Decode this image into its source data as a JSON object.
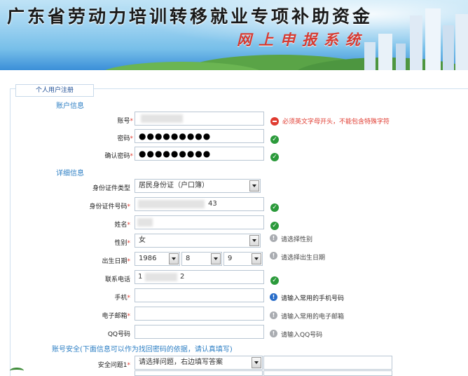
{
  "header": {
    "title": "广东省劳动力培训转移就业专项补助资金",
    "subtitle": "网上申报系统"
  },
  "form": {
    "legend": "个人用户注册",
    "sections": {
      "account": "账户信息",
      "detail": "详细信息",
      "security": "账号安全(下面信息可以作为找回密码的依据，请认真填写)"
    },
    "fields": {
      "username": {
        "label": "账号",
        "hint": "必须英文字母开头，不能包含特殊字符"
      },
      "password": {
        "label": "密码",
        "value": "●●●●●●●●●"
      },
      "confirm_password": {
        "label": "确认密码",
        "value": "●●●●●●●●●"
      },
      "id_type": {
        "label": "身份证件类型",
        "value": "居民身份证（户口簿）"
      },
      "id_number": {
        "label": "身份证件号码",
        "value_suffix": "43"
      },
      "name": {
        "label": "姓名"
      },
      "gender": {
        "label": "性别",
        "value": "女",
        "hint": "请选择性别"
      },
      "birth": {
        "label": "出生日期",
        "year": "1986",
        "month": "8",
        "day": "9",
        "hint": "请选择出生日期"
      },
      "phone": {
        "label": "联系电话",
        "value_prefix": "1",
        "value_suffix": "2"
      },
      "mobile": {
        "label": "手机",
        "hint": "请输入常用的手机号码"
      },
      "email": {
        "label": "电子邮箱",
        "hint": "请输入常用的电子邮箱"
      },
      "qq": {
        "label": "QQ号码",
        "hint": "请输入QQ号码"
      },
      "security_question": {
        "label": "安全问题1",
        "value": "请选择问题，右边填写答案"
      }
    },
    "required_mark": "*"
  },
  "colors": {
    "accent": "#2d7fc4",
    "ok": "#2b9a3b",
    "error": "#e03c31"
  }
}
